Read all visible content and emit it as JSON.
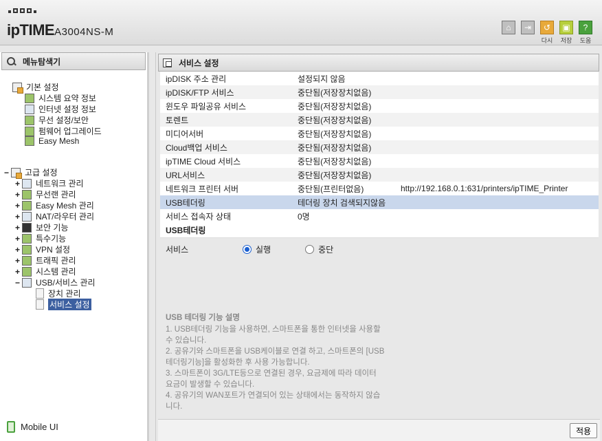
{
  "header": {
    "brand": "ipTIME",
    "model": "A3004NS-M",
    "icons": [
      {
        "name": "home-icon",
        "label": ""
      },
      {
        "name": "logout-icon",
        "label": ""
      },
      {
        "name": "refresh-icon",
        "label": "다시"
      },
      {
        "name": "save-icon",
        "label": "저장"
      },
      {
        "name": "help-icon",
        "label": "도움"
      }
    ]
  },
  "left": {
    "title": "메뉴탐색기",
    "basic": {
      "label": "기본 설정",
      "items": [
        "시스템 요약 정보",
        "인터넷 설정 정보",
        "무선 설정/보안",
        "펌웨어 업그레이드",
        "Easy Mesh"
      ]
    },
    "advanced": {
      "label": "고급 설정",
      "items": [
        "네트워크 관리",
        "무선랜 관리",
        "Easy Mesh 관리",
        "NAT/라우터 관리",
        "보안 기능",
        "특수기능",
        "VPN 설정",
        "트래픽 관리",
        "시스템 관리",
        "USB/서비스 관리"
      ],
      "usb_children": [
        "장치 관리",
        "서비스 설정"
      ]
    },
    "mobile": "Mobile UI"
  },
  "right": {
    "title": "서비스 설정",
    "rows": [
      {
        "name": "ipDISK 주소 관리",
        "status": "설정되지 않음",
        "extra": ""
      },
      {
        "name": "ipDISK/FTP 서비스",
        "status": "중단됨(저장장치없음)",
        "extra": ""
      },
      {
        "name": "윈도우 파일공유 서비스",
        "status": "중단됨(저장장치없음)",
        "extra": ""
      },
      {
        "name": "토렌트",
        "status": "중단됨(저장장치없음)",
        "extra": ""
      },
      {
        "name": "미디어서버",
        "status": "중단됨(저장장치없음)",
        "extra": ""
      },
      {
        "name": "Cloud백업 서비스",
        "status": "중단됨(저장장치없음)",
        "extra": ""
      },
      {
        "name": "ipTIME Cloud 서비스",
        "status": "중단됨(저장장치없음)",
        "extra": ""
      },
      {
        "name": "URL서비스",
        "status": "중단됨(저장장치없음)",
        "extra": ""
      },
      {
        "name": "네트워크 프린터 서버",
        "status": "중단됨(프린터없음)",
        "extra": "http://192.168.0.1:631/printers/ipTIME_Printer"
      },
      {
        "name": "USB테더링",
        "status": "테더링 장치 검색되지않음",
        "extra": ""
      },
      {
        "name": "서비스 접속자 상태",
        "status": "0명",
        "extra": ""
      }
    ],
    "section_title": "USB테더링",
    "service_label": "서비스",
    "radio_on": "실행",
    "radio_off": "중단",
    "desc_title": "USB 테더링 기능 설명",
    "desc_lines": [
      "1. USB테더링 기능을 사용하면, 스마트폰을 통한 인터넷을 사용할",
      "수 있습니다.",
      "2. 공유기와 스마트폰을 USB케이블로 연결 하고, 스마트폰의 [USB",
      "테더링기능]을 활성화한 후 사용 가능합니다.",
      "3. 스마트폰이 3G/LTE등으로 연결된 경우, 요금제에 따라 데이터",
      "요금이 발생할 수 있습니다.",
      "4. 공유기의 WAN포트가 연결되어 있는 상태에서는 동작하지 않습",
      "니다."
    ],
    "apply": "적용"
  }
}
